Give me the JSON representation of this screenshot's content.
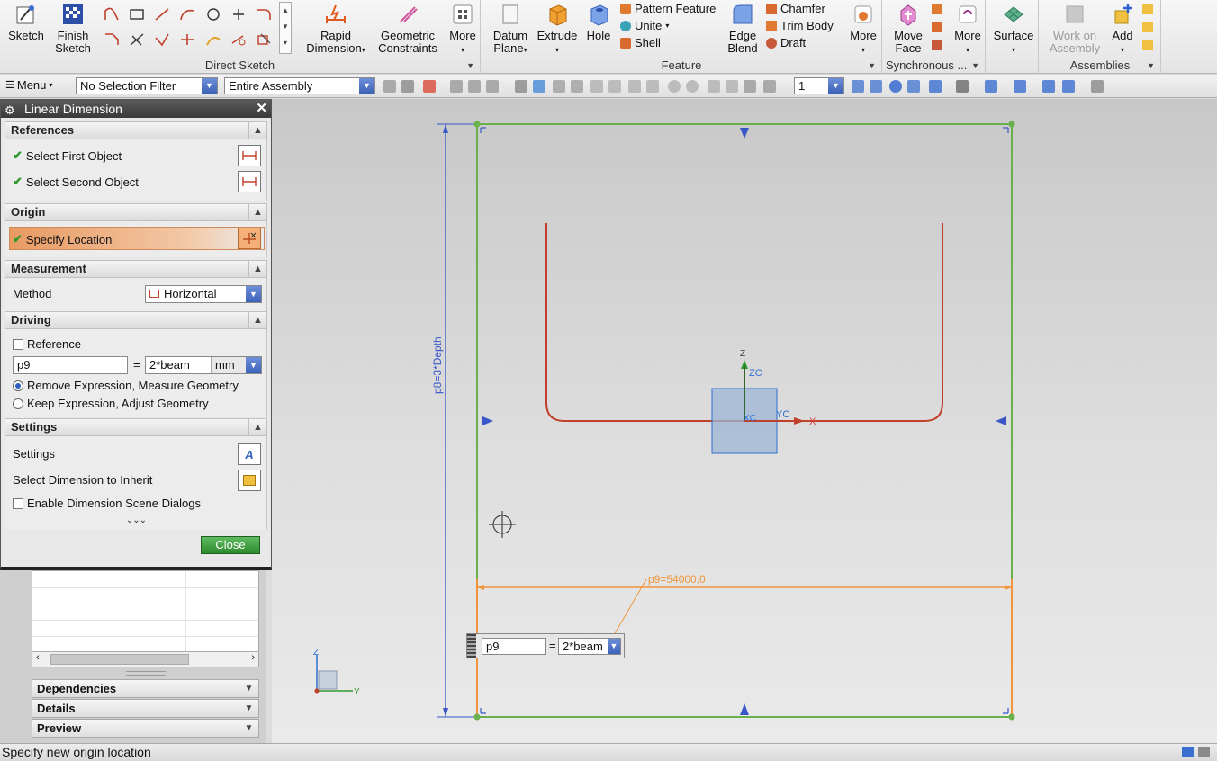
{
  "ribbon": {
    "sketch": "Sketch",
    "finish_sketch": [
      "Finish",
      "Sketch"
    ],
    "rapid_dimension": [
      "Rapid",
      "Dimension"
    ],
    "geometric_constraints": [
      "Geometric",
      "Constraints"
    ],
    "more": "More",
    "direct_sketch_label": "Direct Sketch",
    "datum_plane": [
      "Datum",
      "Plane"
    ],
    "extrude": "Extrude",
    "hole": "Hole",
    "pattern_feature": "Pattern Feature",
    "unite": "Unite",
    "shell": "Shell",
    "edge_blend": [
      "Edge",
      "Blend"
    ],
    "chamfer": "Chamfer",
    "trim_body": "Trim Body",
    "draft": "Draft",
    "feature_more": "More",
    "feature_label": "Feature",
    "move_face": [
      "Move",
      "Face"
    ],
    "sync_more": "More",
    "synchronous_label": "Synchronous ...",
    "surface": "Surface",
    "work_on_assembly": [
      "Work on",
      "Assembly"
    ],
    "add": "Add",
    "assemblies_label": "Assemblies"
  },
  "toolbar": {
    "menu": "Menu",
    "selection_filter": "No Selection Filter",
    "scope": "Entire Assembly",
    "layer": "1"
  },
  "dialog": {
    "title": "Linear Dimension",
    "references": {
      "header": "References",
      "first": "Select First Object",
      "second": "Select Second Object"
    },
    "origin": {
      "header": "Origin",
      "specify_location": "Specify Location"
    },
    "measurement": {
      "header": "Measurement",
      "method_label": "Method",
      "method_value": "Horizontal"
    },
    "driving": {
      "header": "Driving",
      "reference": "Reference",
      "name": "p9",
      "equals": "=",
      "expression": "2*beam",
      "unit": "mm",
      "option_remove": "Remove Expression, Measure Geometry",
      "option_keep": "Keep Expression, Adjust Geometry"
    },
    "settings": {
      "header": "Settings",
      "settings": "Settings",
      "inherit": "Select Dimension to Inherit",
      "enable_dialogs": "Enable Dimension Scene Dialogs"
    },
    "close": "Close"
  },
  "navigator": {
    "dependencies": "Dependencies",
    "details": "Details",
    "preview": "Preview"
  },
  "canvas": {
    "vertical_dimension": "p8=3*Depth",
    "horizontal_dimension": "p9=54000,0",
    "onscreen_name": "p9",
    "onscreen_equals": "=",
    "onscreen_expression": "2*beam",
    "axis_zc": "ZC",
    "axis_yc": "YC",
    "axis_xc": "XC",
    "axis_z": "Z",
    "axis_x": "X",
    "triad_z": "Z",
    "triad_y": "Y"
  },
  "colors": {
    "sketch_border": "#6ab04c",
    "curve": "#c0412b",
    "dimension_horizontal": "#f0953a",
    "dimension_vertical": "#3a56c8",
    "accent": "#2f5fc0"
  },
  "status": "Specify new origin location"
}
